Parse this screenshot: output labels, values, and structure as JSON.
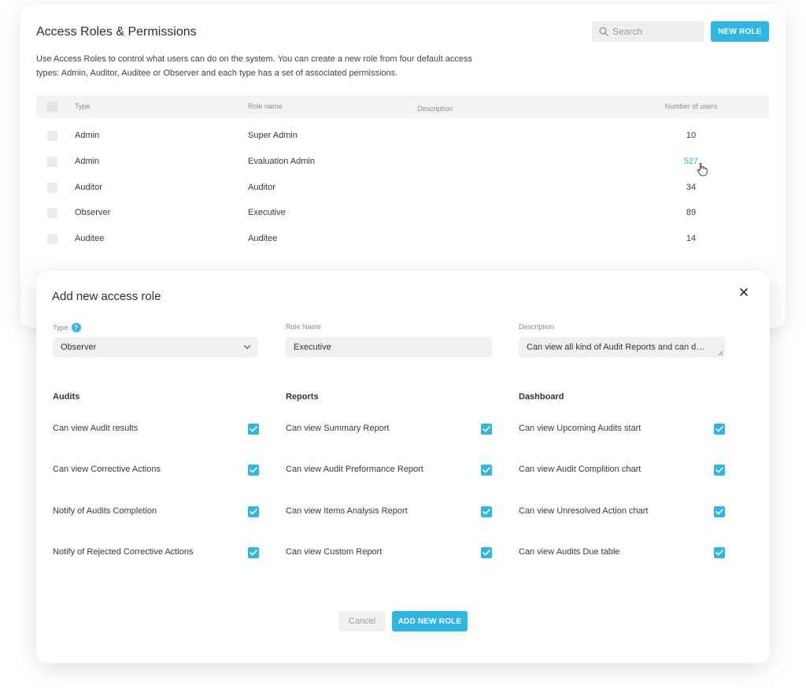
{
  "roles_page": {
    "title": "Access Roles & Permissions",
    "search_placeholder": "Search",
    "new_role_label": "NEW ROLE",
    "description": "Use Access Roles to control what users can do on the system. You can create a new role from four default access types: Admin, Auditor, Auditee or Observer and each type has a set of associated permissions.",
    "table": {
      "headers": {
        "type": "Type",
        "role_name": "Role name",
        "description": "Description",
        "users": "Number of users"
      },
      "rows": [
        {
          "type": "Admin",
          "role_name": "Super Admin",
          "description": "",
          "users": "10"
        },
        {
          "type": "Admin",
          "role_name": "Evaluation Admin",
          "description": "",
          "users": "527"
        },
        {
          "type": "Auditor",
          "role_name": "Auditor",
          "description": "",
          "users": "34"
        },
        {
          "type": "Observer",
          "role_name": "Executive",
          "description": "",
          "users": "89"
        },
        {
          "type": "Auditee",
          "role_name": "Auditee",
          "description": "",
          "users": "14"
        }
      ]
    }
  },
  "modal": {
    "title": "Add new access role",
    "fields": {
      "type_label": "Type",
      "type_value": "Observer",
      "role_name_label": "Role Name",
      "role_name_value": "Executive",
      "description_label": "Description",
      "description_value": "Can view all kind of Audit Reports and can dee.."
    },
    "sections": [
      {
        "title": "Audits",
        "items": [
          {
            "label": "Can view Audit results",
            "checked": true
          },
          {
            "label": "Can view Corrective Actions",
            "checked": true
          },
          {
            "label": "Notify of Audits Completion",
            "checked": true
          },
          {
            "label": "Notify of Rejected Corrective Actions",
            "checked": true
          }
        ]
      },
      {
        "title": "Reports",
        "items": [
          {
            "label": "Can view Summary Report",
            "checked": true
          },
          {
            "label": "Can view Audit Preformance Report",
            "checked": true
          },
          {
            "label": "Can view Items Analysis Report",
            "checked": true
          },
          {
            "label": "Can view Custom Report",
            "checked": true
          }
        ]
      },
      {
        "title": "Dashboard",
        "items": [
          {
            "label": "Can view Upcoming Audits start",
            "checked": true
          },
          {
            "label": "Can view Audit Complition chart",
            "checked": true
          },
          {
            "label": "Can view Unresolved Action chart",
            "checked": true
          },
          {
            "label": "Can view Audits Due table",
            "checked": true
          }
        ]
      }
    ],
    "cancel_label": "Cancel",
    "add_label": "ADD NEW ROLE"
  },
  "colors": {
    "accent": "#2eb6e5",
    "field_bg": "#f1f1f1",
    "header_bg": "#f3f3f3"
  }
}
